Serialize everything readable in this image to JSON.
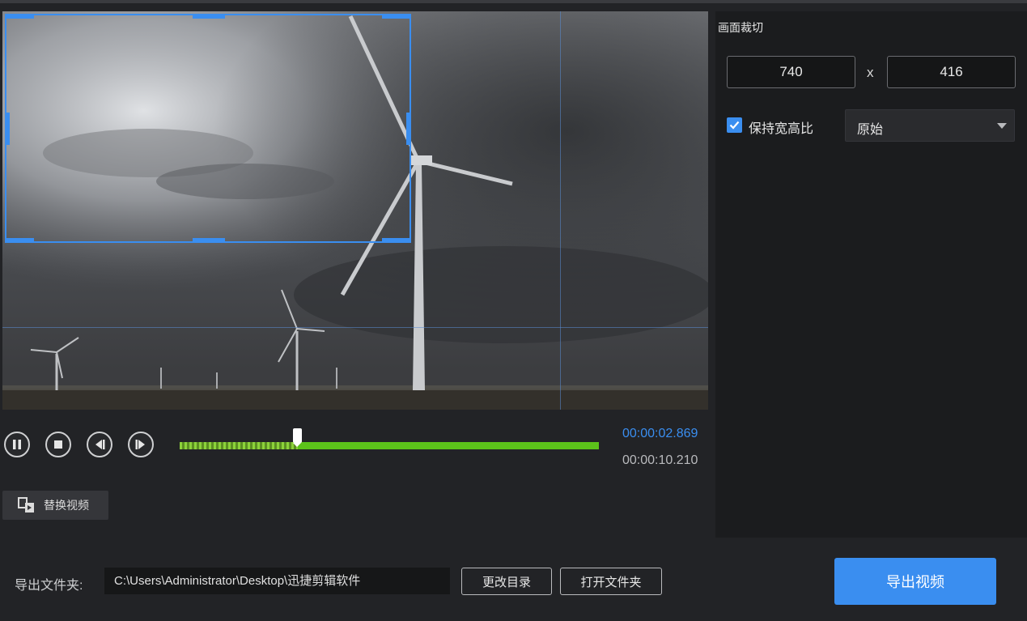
{
  "colors": {
    "accent": "#3a8ef0",
    "timeline": "#5cc31a",
    "panel_bg": "#1b1c1e",
    "window_bg": "#222326"
  },
  "player": {
    "current_time": "00:00:02.869",
    "total_time": "00:00:10.210",
    "progress_fraction": 0.281,
    "controls": [
      {
        "name": "pause-button",
        "icon": "pause-icon"
      },
      {
        "name": "stop-button",
        "icon": "stop-icon"
      },
      {
        "name": "previous-frame-button",
        "icon": "step-back-icon"
      },
      {
        "name": "next-frame-button",
        "icon": "step-forward-icon"
      }
    ],
    "replace_video_label": "替换视频",
    "replace_video_icon": "replace-video-icon"
  },
  "crop_panel": {
    "title": "画面裁切",
    "width_value": "740",
    "height_value": "416",
    "times_symbol": "x",
    "keep_ratio_label": "保持宽高比",
    "keep_ratio_checked": true,
    "ratio_selected": "原始",
    "ratio_icon": "chevron-down-icon"
  },
  "export": {
    "folder_label": "导出文件夹:",
    "folder_path": "C:\\Users\\Administrator\\Desktop\\迅捷剪辑软件",
    "change_dir_label": "更改目录",
    "open_folder_label": "打开文件夹",
    "export_button_label": "导出视频"
  }
}
